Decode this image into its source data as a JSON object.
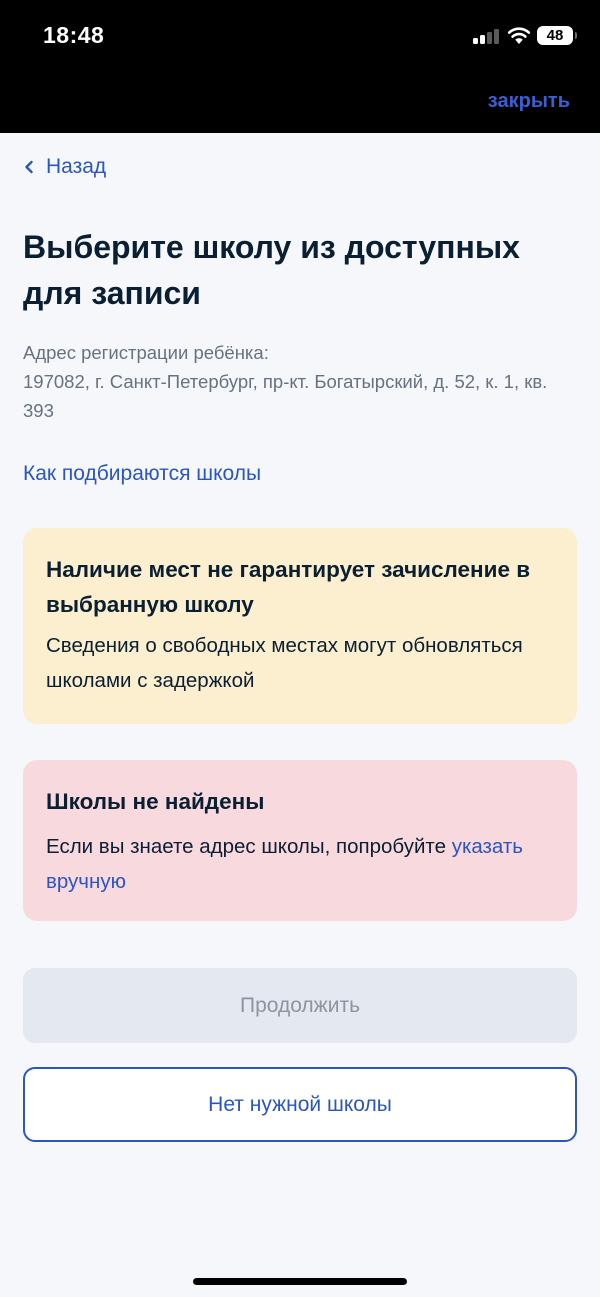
{
  "status_bar": {
    "time": "18:48",
    "battery": "48",
    "icons": [
      "cellular-signal-icon",
      "wifi-icon",
      "battery-icon"
    ]
  },
  "top_bar": {
    "close_label": "закрыть"
  },
  "nav": {
    "back_label": "Назад",
    "back_icon": "chevron-left-icon"
  },
  "page": {
    "title": "Выберите школу из доступных для записи",
    "address_label": "Адрес регистрации ребёнка:",
    "address_value": "197082, г. Санкт-Петербург, пр-кт. Богатырский, д. 52, к. 1, кв. 393",
    "how_link": "Как подбираются школы"
  },
  "warning_card": {
    "title": "Наличие мест не гарантирует зачисление в выбранную школу",
    "text": "Сведения о свободных местах могут обновляться школами с задержкой",
    "color": "#fbefcf"
  },
  "error_card": {
    "title": "Школы не найдены",
    "text": "Если вы знаете адрес школы, попробуйте",
    "link": "указать вручную",
    "color": "#f8d9de"
  },
  "buttons": {
    "continue_label": "Продолжить",
    "continue_disabled": true,
    "no_school_label": "Нет нужной школы"
  },
  "colors": {
    "accent": "#2b55bf",
    "text": "#0b1f33",
    "secondary_text": "#66727f",
    "background": "#f5f7fb"
  }
}
